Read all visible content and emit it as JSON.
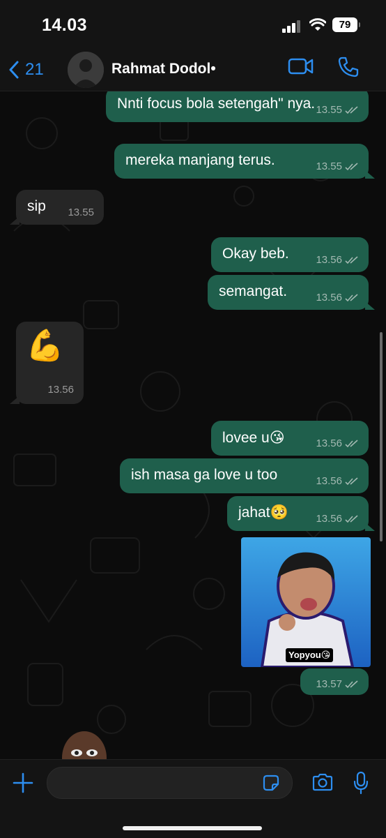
{
  "status_bar": {
    "time": "14.03",
    "battery": "79"
  },
  "header": {
    "back_count": "21",
    "contact_name": "Rahmat Dodol•"
  },
  "messages": [
    {
      "text": "Nnti focus bola setengah\" nya.",
      "time": "13.55"
    },
    {
      "text": "mereka manjang terus.",
      "time": "13.55"
    },
    {
      "text": "sip",
      "time": "13.55"
    },
    {
      "text": "Okay beb.",
      "time": "13.56"
    },
    {
      "text": "semangat.",
      "time": "13.56"
    },
    {
      "text": "💪",
      "time": "13.56"
    },
    {
      "text": "lovee u😘",
      "time": "13.56"
    },
    {
      "text": "ish masa ga love u too",
      "time": "13.56"
    },
    {
      "text": "jahat🥺",
      "time": "13.56"
    },
    {
      "text": "Yopyou😘",
      "time": "13.57"
    }
  ],
  "colors": {
    "accent": "#2d8ef0",
    "outgoing_bubble": "#1f5f4c",
    "incoming_bubble": "#262626",
    "background": "#0b0b0b"
  },
  "icons": [
    "chevron-left-icon",
    "video-call-icon",
    "phone-icon",
    "plus-icon",
    "sticker-icon",
    "camera-icon",
    "mic-icon",
    "double-check-icon"
  ]
}
